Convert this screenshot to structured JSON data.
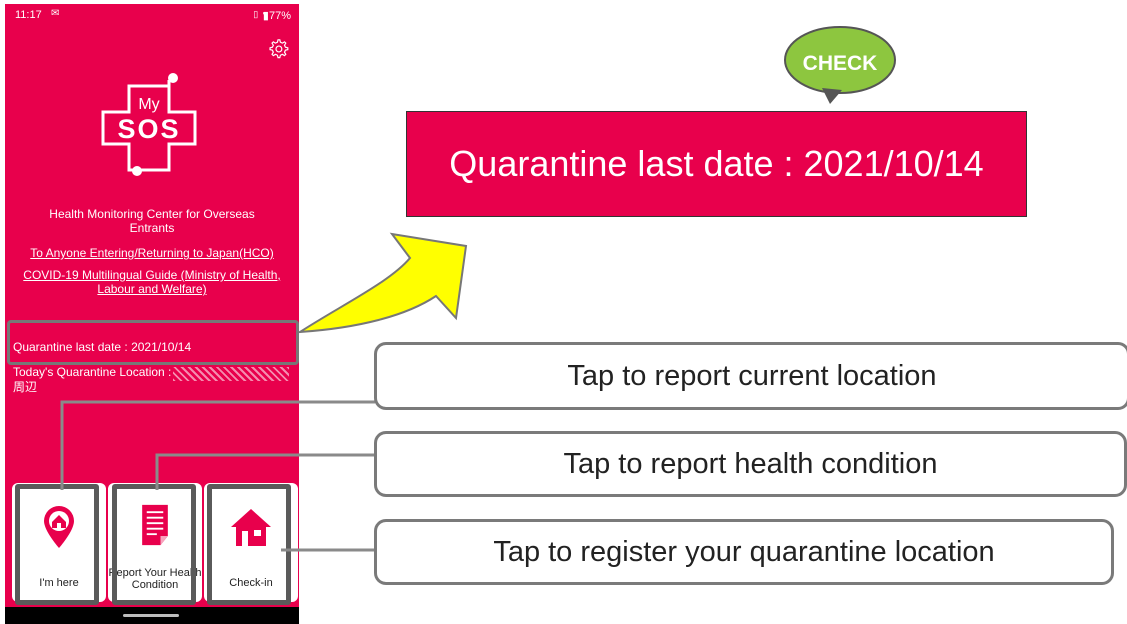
{
  "status_bar": {
    "time": "11:17",
    "mail_glyph": "M",
    "battery": "77%"
  },
  "app": {
    "logo_my": "My",
    "logo_sos": "SOS",
    "center_title": "Health Monitoring Center for Overseas Entrants",
    "link_hco": "To Anyone Entering/Returning to Japan(HCO)",
    "link_guide": "COVID-19 Multilingual Guide (Ministry of Health, Labour and Welfare)",
    "quarantine_date": "Quarantine last date : 2021/10/14",
    "quarantine_location_label": "Today's Quarantine Location :",
    "quarantine_location_suffix": "周辺"
  },
  "tiles": [
    {
      "label": "I'm here",
      "icon": "location-pin-home-icon"
    },
    {
      "label": "Report Your Health Condition",
      "icon": "document-icon"
    },
    {
      "label": "Check-in",
      "icon": "house-icon"
    }
  ],
  "check_badge": "CHECK",
  "banner": "Quarantine last date : 2021/10/14",
  "callouts": {
    "location": "Tap to report current location",
    "health": "Tap to report health condition",
    "register": "Tap to register your quarantine location"
  },
  "colors": {
    "app_red": "#e8004c",
    "badge_green": "#8dc63f",
    "arrow_yellow": "#ffff00",
    "frame_gray": "#7a7a7a"
  }
}
